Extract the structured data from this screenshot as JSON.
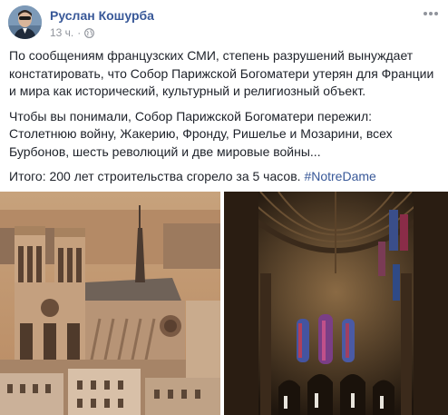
{
  "post": {
    "author": "Руслан Кошурба",
    "time": "13 ч.",
    "separator": "·",
    "privacy_icon": "globe-icon",
    "options_icon": "more-options-icon"
  },
  "content": {
    "paragraph1": "По сообщениям французских СМИ, степень разрушений вынуждает констатировать, что Собор Парижской Богоматери утерян для Франции и мира как исторический, культурный и религиозный объект.",
    "paragraph2": "Чтобы вы понимали, Собор Парижской Богоматери пережил: Столетнюю войну, Жакерию, Фронду, Ришелье и Мозарини, всех Бурбонов, шесть революций и две мировые войны...",
    "paragraph3_text": "Итого: 200 лет строительства сгорело за 5 часов. ",
    "hashtag": "#NotreDame"
  },
  "photos": [
    {
      "description_icon": "cathedral-exterior-photo"
    },
    {
      "description_icon": "cathedral-interior-photo"
    }
  ],
  "colors": {
    "link": "#385898",
    "text": "#1d2129",
    "meta": "#90949c"
  }
}
